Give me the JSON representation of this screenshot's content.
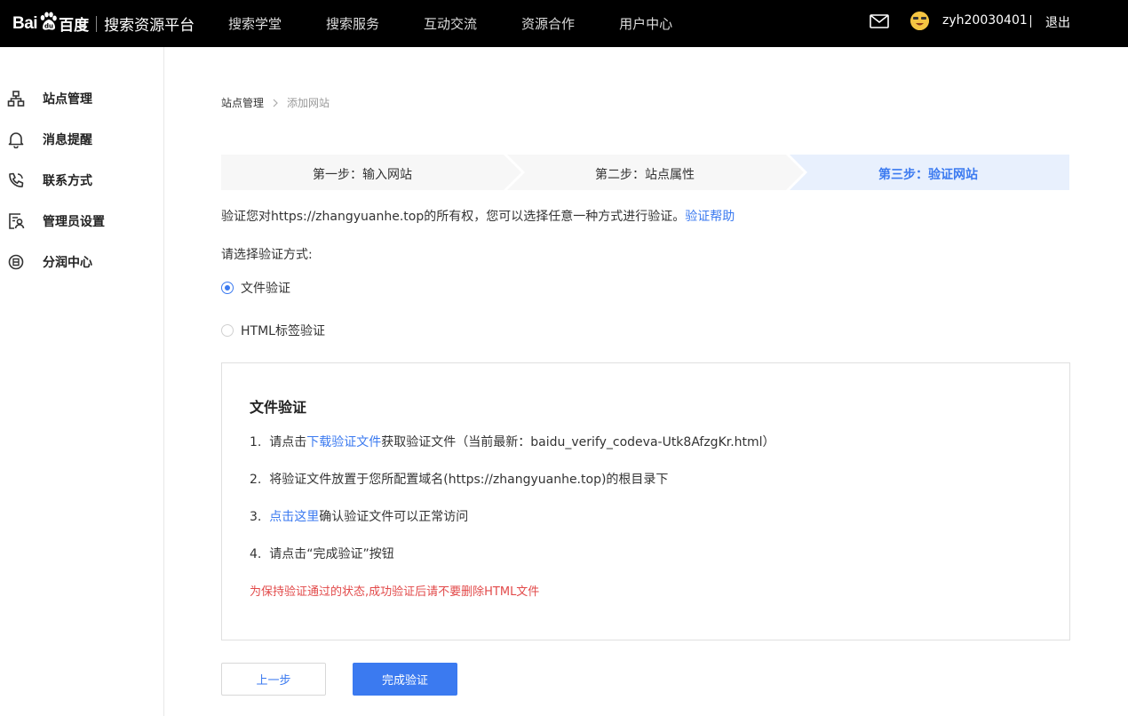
{
  "header": {
    "logo_left": "Bai",
    "logo_right": "百度",
    "platform_name": "搜索资源平台",
    "nav": [
      "搜索学堂",
      "搜索服务",
      "互动交流",
      "资源合作",
      "用户中心"
    ],
    "username": "zyh20030401",
    "logout": "退出"
  },
  "sidebar": {
    "items": [
      {
        "label": "站点管理",
        "icon": "sitemap-icon"
      },
      {
        "label": "消息提醒",
        "icon": "bell-icon"
      },
      {
        "label": "联系方式",
        "icon": "phone-icon"
      },
      {
        "label": "管理员设置",
        "icon": "admin-icon"
      },
      {
        "label": "分润中心",
        "icon": "revenue-icon"
      }
    ]
  },
  "breadcrumb": {
    "home": "站点管理",
    "separator": ">",
    "current": "添加网站"
  },
  "steps": [
    {
      "label": "第一步：输入网站",
      "active": false
    },
    {
      "label": "第二步：站点属性",
      "active": false
    },
    {
      "label": "第三步：验证网站",
      "active": true
    }
  ],
  "intro": {
    "text": "验证您对https://zhangyuanhe.top的所有权，您可以选择任意一种方式进行验证。",
    "help_link": "验证帮助"
  },
  "choose_label": "请选择验证方式:",
  "methods": [
    {
      "label": "文件验证",
      "checked": true
    },
    {
      "label": "HTML标签验证",
      "checked": false
    }
  ],
  "panel": {
    "title": "文件验证",
    "step1_prefix": "1.  请点击",
    "step1_link": "下载验证文件",
    "step1_suffix": "获取验证文件（当前最新：baidu_verify_codeva-Utk8AfzgKr.html）",
    "step2": "2.  将验证文件放置于您所配置域名(https://zhangyuanhe.top)的根目录下",
    "step3_prefix": "3.  ",
    "step3_link": "点击这里",
    "step3_suffix": "确认验证文件可以正常访问",
    "step4": "4.  请点击“完成验证”按钮",
    "warning": "为保持验证通过的状态,成功验证后请不要删除HTML文件"
  },
  "buttons": {
    "prev": "上一步",
    "done": "完成验证"
  },
  "colors": {
    "accent": "#3b7af0",
    "warning": "#e24a4a",
    "step_active_bg": "#e8f0fd",
    "step_bg": "#f7f7f7"
  }
}
